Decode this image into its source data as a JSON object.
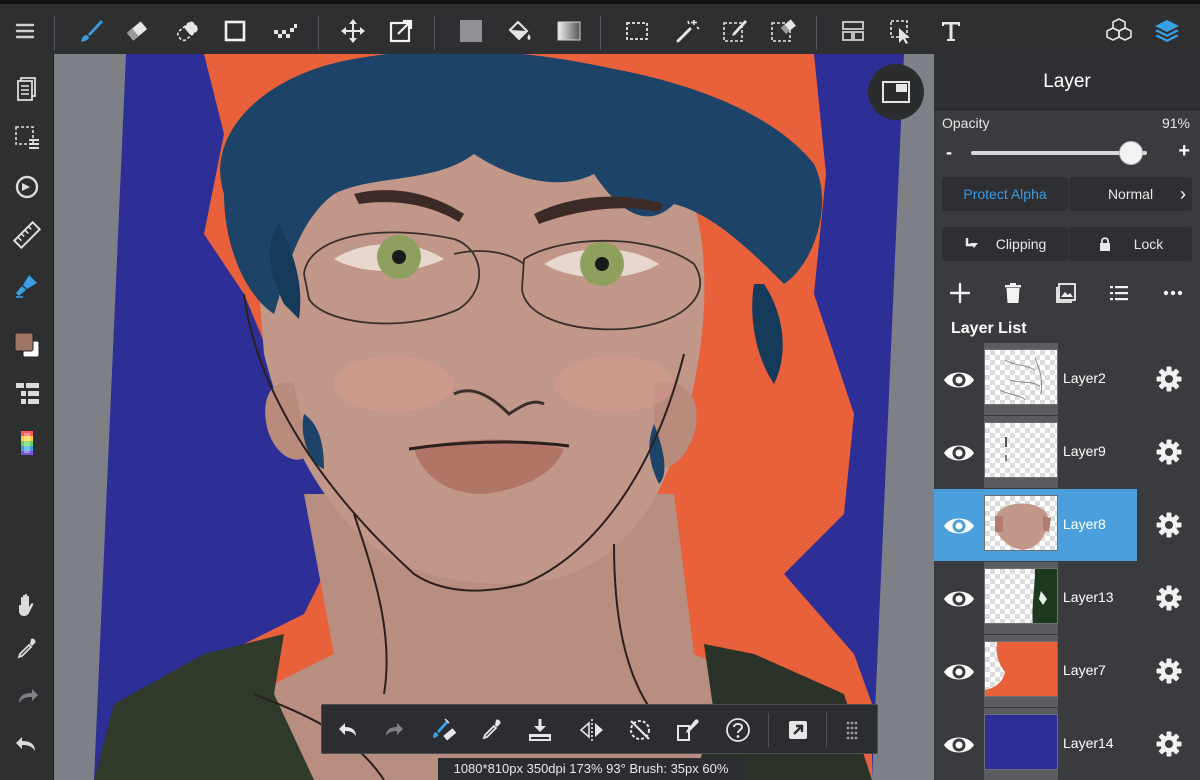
{
  "toolbar": {
    "accent": "#3a9ee4",
    "tools": [
      "menu-icon",
      "brush-icon",
      "eraser-icon",
      "blur-icon",
      "shape-icon",
      "dot-icon",
      "move-icon",
      "transform-icon",
      "fill-color-icon",
      "bucket-icon",
      "gradient-icon",
      "select-icon",
      "magic-wand-icon",
      "select-pen-icon",
      "select-eraser-icon",
      "frame-icon",
      "lasso-icon",
      "text-icon",
      "materials-icon",
      "layers-icon"
    ]
  },
  "canvas": {
    "status_text": "1080*810px 350dpi 173% 93° Brush: 35px 60%",
    "colors": {
      "background_blue": "#2e2f96",
      "outline_orange": "#e8613a",
      "skin": "#c09789",
      "hair": "#1d4468",
      "eye_green": "#8fa05e"
    }
  },
  "layer_panel": {
    "title": "Layer",
    "opacity_label": "Opacity",
    "opacity_value": "91%",
    "opacity_fraction": 0.91,
    "minus": "-",
    "plus": "+",
    "protect_alpha": "Protect Alpha",
    "blend_mode": "Normal",
    "clipping": "Clipping",
    "lock": "Lock",
    "layer_list_title": "Layer List",
    "layers": [
      {
        "name": "Layer2",
        "active": false
      },
      {
        "name": "Layer9",
        "active": false
      },
      {
        "name": "Layer8",
        "active": true
      },
      {
        "name": "Layer13",
        "active": false
      },
      {
        "name": "Layer7",
        "active": false
      },
      {
        "name": "Layer14",
        "active": false
      }
    ]
  }
}
